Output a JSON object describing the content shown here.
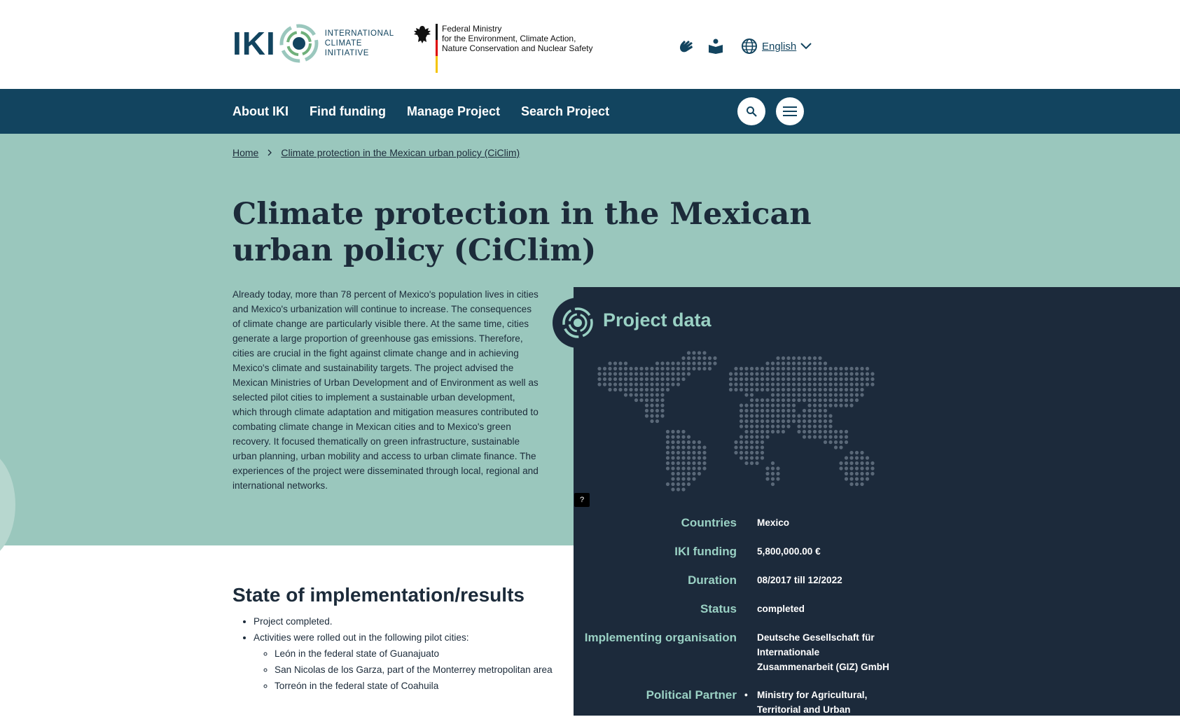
{
  "header": {
    "logo_letters": "IKI",
    "logo_sub": [
      "INTERNATIONAL",
      "CLIMATE",
      "INITIATIVE"
    ],
    "ministry_lines": [
      "Federal Ministry",
      "for the Environment, Climate Action,",
      "Nature Conservation and Nuclear Safety"
    ],
    "language": "English"
  },
  "nav": {
    "items": [
      "About IKI",
      "Find funding",
      "Manage Project",
      "Search Project"
    ]
  },
  "breadcrumb": {
    "home": "Home",
    "current": "Climate protection in the Mexican urban policy (CiClim)"
  },
  "page": {
    "title": "Climate protection in the Mexican urban policy (CiClim)",
    "intro": "Already today, more than 78 percent of Mexico's population lives in cities and Mexico's urbanization will continue to increase. The consequences of climate change are particularly visible there. At the same time, cities generate a large proportion of greenhouse gas emissions. Therefore, cities are crucial in the fight against climate change and in achieving Mexico's climate and sustainability targets. The project advised the Mexican Ministries of Urban Development and of Environment as well as selected pilot cities to implement a sustainable urban development, which through climate adaptation and mitigation measures contributed to combating climate change in Mexican cities and to Mexico's green recovery. It focused thematically on green infrastructure, sustainable urban planning, urban mobility and access to urban climate finance. The experiences of the project were disseminated through local, regional and international networks."
  },
  "project_data": {
    "title": "Project data",
    "map_info": "?",
    "rows": [
      {
        "label": "Countries",
        "value": "Mexico"
      },
      {
        "label": "IKI funding",
        "value": "5,800,000.00 €"
      },
      {
        "label": "Duration",
        "value": "08/2017 till 12/2022"
      },
      {
        "label": "Status",
        "value": "completed"
      },
      {
        "label": "Implementing organisation",
        "value": "Deutsche Gesellschaft für Internationale Zusammenarbeit (GIZ) GmbH"
      },
      {
        "label": "Political Partner",
        "value": "Ministry for Agricultural, Territorial and Urban"
      }
    ]
  },
  "results": {
    "title": "State of implementation/results",
    "items": [
      "Project completed.",
      "Activities were rolled out in the following pilot cities:"
    ],
    "sub_items": [
      "León in the federal state of Guanajuato",
      "San Nicolas de los Garza, part of the Monterrey metropolitan area",
      "Torreón in the federal state of Coahuila"
    ]
  },
  "colors": {
    "nav_bg": "#12445f",
    "hero_bg": "#9ac7bd",
    "panel_bg": "#1c2a3b",
    "accent_teal": "#9ad1c4"
  }
}
